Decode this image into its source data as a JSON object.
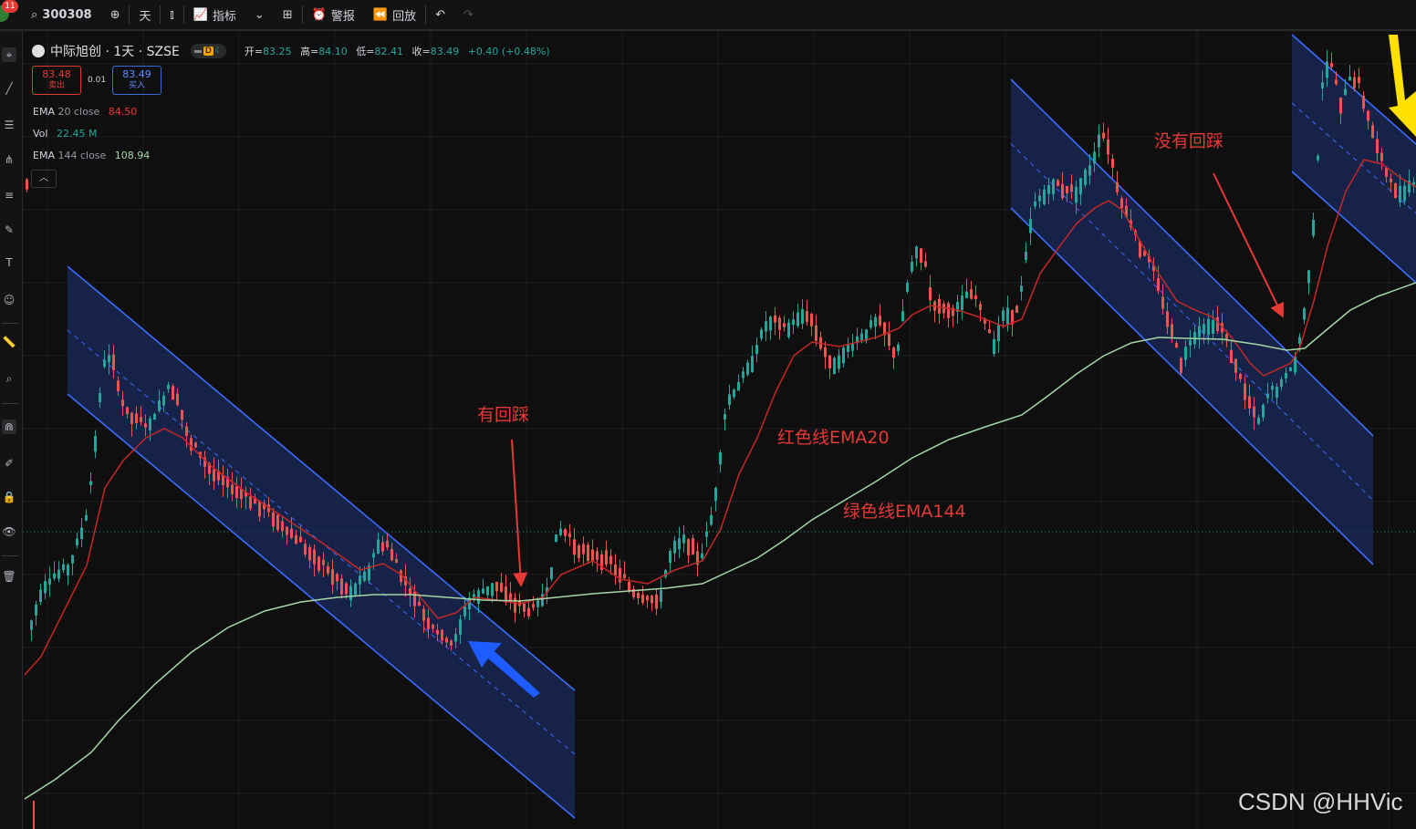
{
  "toolbar": {
    "notification_count": "11",
    "symbol": "300308",
    "interval": "天",
    "indicators_label": "指标",
    "alert_label": "警报",
    "replay_label": "回放"
  },
  "legend": {
    "title": "中际旭创 · 1天 · SZSE",
    "mode_letter": "D",
    "open_label": "开=",
    "open_value": "83.25",
    "high_label": "高=",
    "high_value": "84.10",
    "low_label": "低=",
    "low_value": "82.41",
    "close_label": "收=",
    "close_value": "83.49",
    "change": "+0.40 (+0.48%)"
  },
  "trade": {
    "sell_price": "83.48",
    "sell_label": "卖出",
    "spread": "0.01",
    "buy_price": "83.49",
    "buy_label": "买入"
  },
  "indicators": [
    {
      "name": "EMA",
      "params": "20 close",
      "value": "84.50",
      "color": "#e53935"
    },
    {
      "name": "Vol",
      "params": "",
      "value": "22.45 M",
      "color": "#26a69a"
    },
    {
      "name": "EMA",
      "params": "144 close",
      "value": "108.94",
      "color": "#a5d6a7"
    }
  ],
  "annotations": {
    "pullback": "有回踩",
    "no_pullback": "没有回踩",
    "red_line": "红色线EMA20",
    "green_line": "绿色线EMA144"
  },
  "watermark": "CSDN @HHVic",
  "colors": {
    "up": "#26a69a",
    "down": "#ef5350",
    "ema20": "#c62828",
    "ema144": "#a5d6a7",
    "channel_line": "#3d6cff",
    "channel_fill": "#1a2a5a",
    "annotation": "#e53935",
    "blue_arrow": "#1e5cff",
    "yellow_arrow": "#ffe000"
  },
  "chart_data": {
    "type": "candlestick",
    "symbol": "中际旭创",
    "last": {
      "open": 83.25,
      "high": 84.1,
      "low": 82.41,
      "close": 83.49
    },
    "overlays": [
      "EMA 20 close",
      "EMA 144 close"
    ],
    "ema20_last": 84.5,
    "ema144_last": 108.94,
    "annotations": [
      "有回踩",
      "没有回踩",
      "红色线EMA20",
      "绿色线EMA144"
    ]
  }
}
